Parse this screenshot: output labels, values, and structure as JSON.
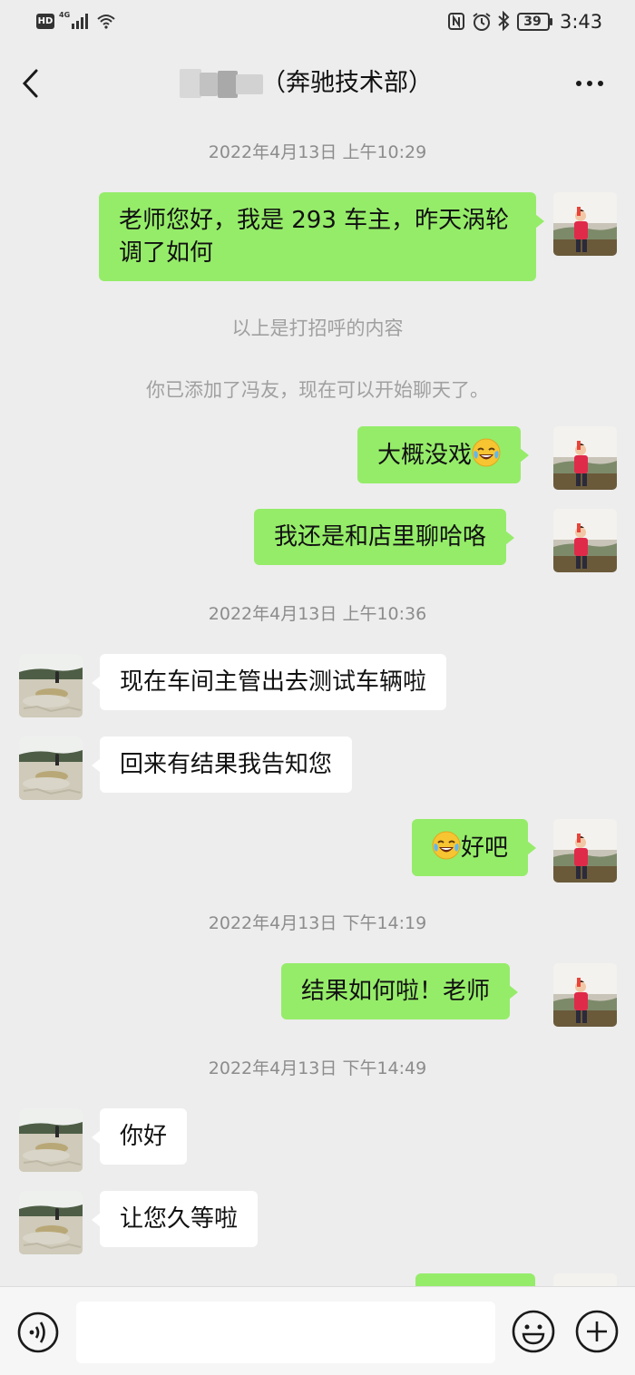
{
  "status_bar": {
    "hd_label": "HD",
    "network_type": "4G",
    "battery_level": "39",
    "time": "3:43"
  },
  "header": {
    "title": "（奔驰技术部）"
  },
  "messages": {
    "ts1": "2022年4月13日 上午10:29",
    "m1_text": "老师您好，我是 293 车主，昨天涡轮调了如何",
    "sys1": "以上是打招呼的内容",
    "sys2": "你已添加了冯友，现在可以开始聊天了。",
    "m2_text": "大概没戏",
    "m3_text": "我还是和店里聊哈咯",
    "ts2": "2022年4月13日 上午10:36",
    "m4_text": "现在车间主管出去测试车辆啦",
    "m5_text": "回来有结果我告知您",
    "m6_text": "好吧",
    "ts3": "2022年4月13日 下午14:19",
    "m7_text": "结果如何啦！老师",
    "ts4": "2022年4月13日 下午14:49",
    "m8_text": "你好",
    "m9_text": "让您久等啦"
  },
  "icons": {
    "emoji_in_messages": "face-with-tears-of-joy",
    "back": "chevron-left-icon",
    "more": "more-dots-icon",
    "voice": "voice-icon",
    "emoji_button": "smiley-icon",
    "plus": "plus-icon"
  },
  "colors": {
    "background": "#ededed",
    "my_bubble": "#95ec69",
    "their_bubble": "#ffffff",
    "timestamp_text": "#8c8c8c"
  }
}
